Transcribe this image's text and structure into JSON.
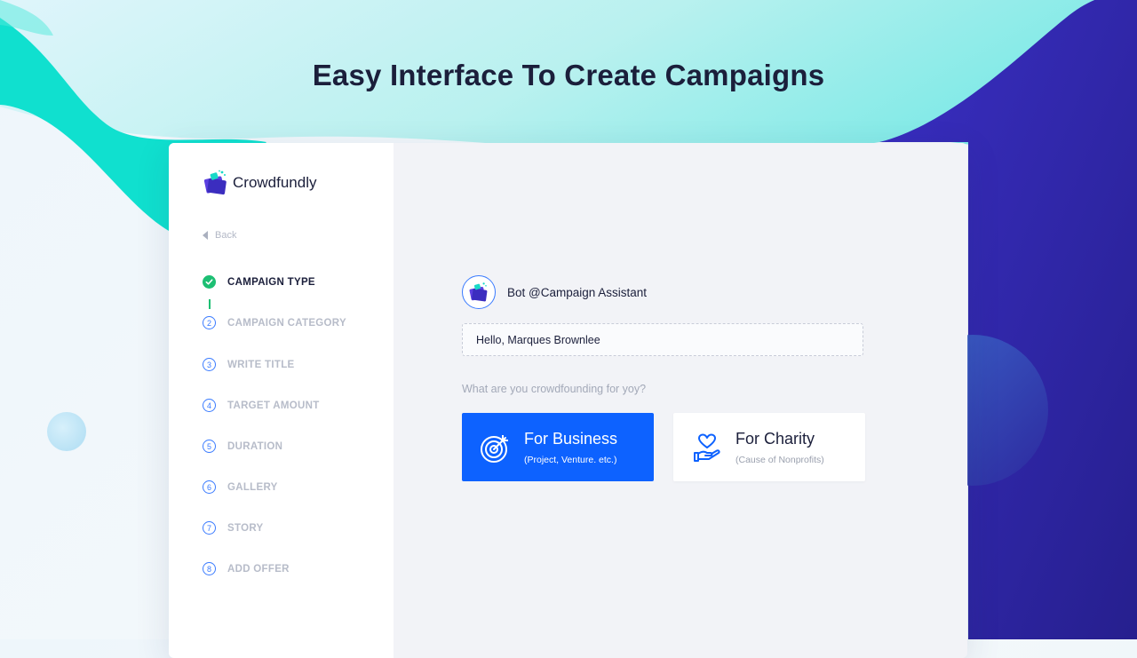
{
  "headline": "Easy Interface To Create Campaigns",
  "brand": {
    "name": "Crowdfundly"
  },
  "sidebar": {
    "back_label": "Back",
    "steps": [
      {
        "number": "",
        "label": "CAMPAIGN TYPE",
        "state": "completed"
      },
      {
        "number": "2",
        "label": "CAMPAIGN CATEGORY",
        "state": "pending"
      },
      {
        "number": "3",
        "label": "WRITE TITLE",
        "state": "pending"
      },
      {
        "number": "4",
        "label": "TARGET AMOUNT",
        "state": "pending"
      },
      {
        "number": "5",
        "label": "DURATION",
        "state": "pending"
      },
      {
        "number": "6",
        "label": "GALLERY",
        "state": "pending"
      },
      {
        "number": "7",
        "label": "STORY",
        "state": "pending"
      },
      {
        "number": "8",
        "label": "ADD OFFER",
        "state": "pending"
      }
    ]
  },
  "chat": {
    "bot_name": "Bot @Campaign Assistant",
    "greeting": "Hello, Marques Brownlee",
    "question": "What are you crowdfounding for yoy?"
  },
  "options": {
    "business": {
      "title": "For Business",
      "subtitle": "(Project, Venture. etc.)",
      "icon": "target-icon"
    },
    "charity": {
      "title": "For Charity",
      "subtitle": "(Cause of Nonprofits)",
      "icon": "heart-hand-icon"
    }
  },
  "colors": {
    "accent": "#0d62ff",
    "success": "#1dbf73",
    "teal": "#14e3cf",
    "indigo": "#2b24a0"
  }
}
